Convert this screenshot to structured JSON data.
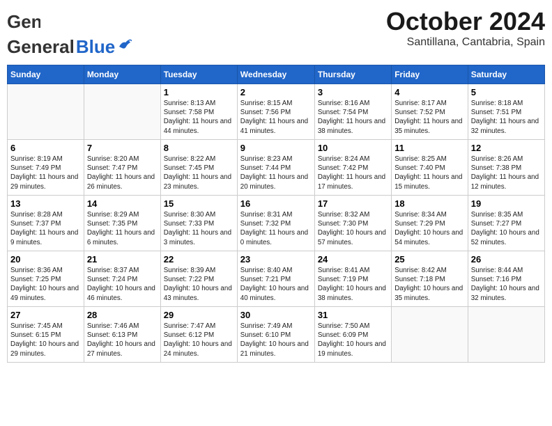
{
  "logo": {
    "text_general": "General",
    "text_blue": "Blue"
  },
  "title": {
    "month_year": "October 2024",
    "location": "Santillana, Cantabria, Spain"
  },
  "days_of_week": [
    "Sunday",
    "Monday",
    "Tuesday",
    "Wednesday",
    "Thursday",
    "Friday",
    "Saturday"
  ],
  "weeks": [
    [
      {
        "day": "",
        "info": ""
      },
      {
        "day": "",
        "info": ""
      },
      {
        "day": "1",
        "info": "Sunrise: 8:13 AM\nSunset: 7:58 PM\nDaylight: 11 hours and 44 minutes."
      },
      {
        "day": "2",
        "info": "Sunrise: 8:15 AM\nSunset: 7:56 PM\nDaylight: 11 hours and 41 minutes."
      },
      {
        "day": "3",
        "info": "Sunrise: 8:16 AM\nSunset: 7:54 PM\nDaylight: 11 hours and 38 minutes."
      },
      {
        "day": "4",
        "info": "Sunrise: 8:17 AM\nSunset: 7:52 PM\nDaylight: 11 hours and 35 minutes."
      },
      {
        "day": "5",
        "info": "Sunrise: 8:18 AM\nSunset: 7:51 PM\nDaylight: 11 hours and 32 minutes."
      }
    ],
    [
      {
        "day": "6",
        "info": "Sunrise: 8:19 AM\nSunset: 7:49 PM\nDaylight: 11 hours and 29 minutes."
      },
      {
        "day": "7",
        "info": "Sunrise: 8:20 AM\nSunset: 7:47 PM\nDaylight: 11 hours and 26 minutes."
      },
      {
        "day": "8",
        "info": "Sunrise: 8:22 AM\nSunset: 7:45 PM\nDaylight: 11 hours and 23 minutes."
      },
      {
        "day": "9",
        "info": "Sunrise: 8:23 AM\nSunset: 7:44 PM\nDaylight: 11 hours and 20 minutes."
      },
      {
        "day": "10",
        "info": "Sunrise: 8:24 AM\nSunset: 7:42 PM\nDaylight: 11 hours and 17 minutes."
      },
      {
        "day": "11",
        "info": "Sunrise: 8:25 AM\nSunset: 7:40 PM\nDaylight: 11 hours and 15 minutes."
      },
      {
        "day": "12",
        "info": "Sunrise: 8:26 AM\nSunset: 7:38 PM\nDaylight: 11 hours and 12 minutes."
      }
    ],
    [
      {
        "day": "13",
        "info": "Sunrise: 8:28 AM\nSunset: 7:37 PM\nDaylight: 11 hours and 9 minutes."
      },
      {
        "day": "14",
        "info": "Sunrise: 8:29 AM\nSunset: 7:35 PM\nDaylight: 11 hours and 6 minutes."
      },
      {
        "day": "15",
        "info": "Sunrise: 8:30 AM\nSunset: 7:33 PM\nDaylight: 11 hours and 3 minutes."
      },
      {
        "day": "16",
        "info": "Sunrise: 8:31 AM\nSunset: 7:32 PM\nDaylight: 11 hours and 0 minutes."
      },
      {
        "day": "17",
        "info": "Sunrise: 8:32 AM\nSunset: 7:30 PM\nDaylight: 10 hours and 57 minutes."
      },
      {
        "day": "18",
        "info": "Sunrise: 8:34 AM\nSunset: 7:29 PM\nDaylight: 10 hours and 54 minutes."
      },
      {
        "day": "19",
        "info": "Sunrise: 8:35 AM\nSunset: 7:27 PM\nDaylight: 10 hours and 52 minutes."
      }
    ],
    [
      {
        "day": "20",
        "info": "Sunrise: 8:36 AM\nSunset: 7:25 PM\nDaylight: 10 hours and 49 minutes."
      },
      {
        "day": "21",
        "info": "Sunrise: 8:37 AM\nSunset: 7:24 PM\nDaylight: 10 hours and 46 minutes."
      },
      {
        "day": "22",
        "info": "Sunrise: 8:39 AM\nSunset: 7:22 PM\nDaylight: 10 hours and 43 minutes."
      },
      {
        "day": "23",
        "info": "Sunrise: 8:40 AM\nSunset: 7:21 PM\nDaylight: 10 hours and 40 minutes."
      },
      {
        "day": "24",
        "info": "Sunrise: 8:41 AM\nSunset: 7:19 PM\nDaylight: 10 hours and 38 minutes."
      },
      {
        "day": "25",
        "info": "Sunrise: 8:42 AM\nSunset: 7:18 PM\nDaylight: 10 hours and 35 minutes."
      },
      {
        "day": "26",
        "info": "Sunrise: 8:44 AM\nSunset: 7:16 PM\nDaylight: 10 hours and 32 minutes."
      }
    ],
    [
      {
        "day": "27",
        "info": "Sunrise: 7:45 AM\nSunset: 6:15 PM\nDaylight: 10 hours and 29 minutes."
      },
      {
        "day": "28",
        "info": "Sunrise: 7:46 AM\nSunset: 6:13 PM\nDaylight: 10 hours and 27 minutes."
      },
      {
        "day": "29",
        "info": "Sunrise: 7:47 AM\nSunset: 6:12 PM\nDaylight: 10 hours and 24 minutes."
      },
      {
        "day": "30",
        "info": "Sunrise: 7:49 AM\nSunset: 6:10 PM\nDaylight: 10 hours and 21 minutes."
      },
      {
        "day": "31",
        "info": "Sunrise: 7:50 AM\nSunset: 6:09 PM\nDaylight: 10 hours and 19 minutes."
      },
      {
        "day": "",
        "info": ""
      },
      {
        "day": "",
        "info": ""
      }
    ]
  ]
}
